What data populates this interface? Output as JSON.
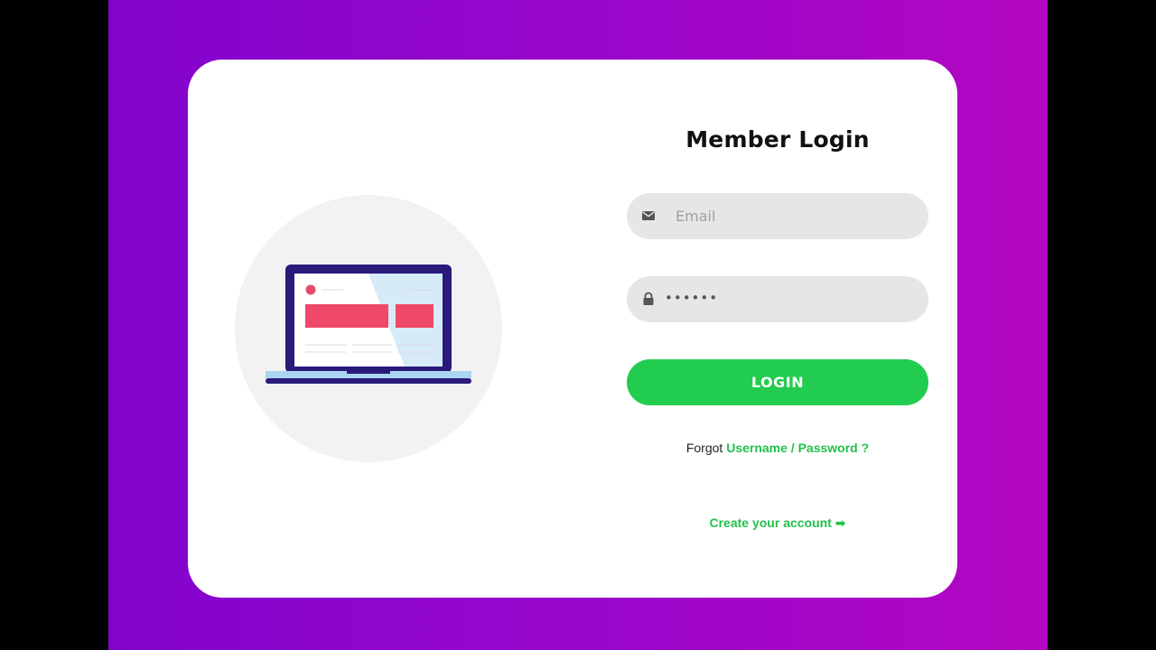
{
  "login_form": {
    "title": "Member Login",
    "email_placeholder": "Email",
    "password_value": "••••••",
    "login_label": "LOGIN",
    "forgot_prefix": "Forgot",
    "forgot_link": "Username / Password ?",
    "create_account": "Create your account ➡"
  },
  "icons": {
    "email": "envelope-icon",
    "password": "lock-icon",
    "illustration": "laptop-illustration"
  },
  "colors": {
    "background_gradient_start": "#8204cc",
    "background_gradient_end": "#b307c2",
    "accent_green": "#22cc4e",
    "input_background": "#e6e6e6",
    "card_background": "#ffffff"
  }
}
